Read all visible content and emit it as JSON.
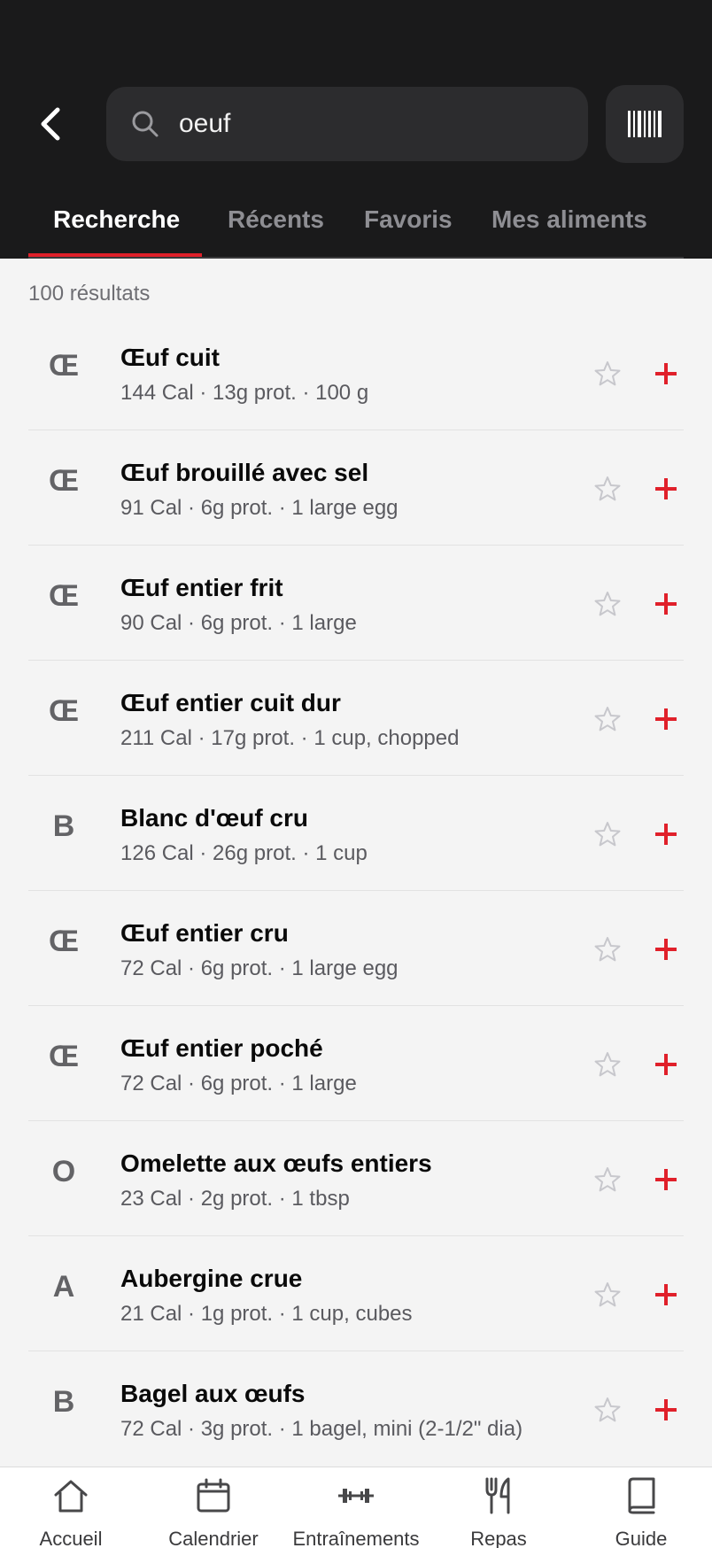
{
  "search": {
    "value": "oeuf",
    "placeholder": ""
  },
  "tabs": [
    {
      "label": "Recherche",
      "active": true
    },
    {
      "label": "Récents",
      "active": false
    },
    {
      "label": "Favoris",
      "active": false
    },
    {
      "label": "Mes aliments",
      "active": false
    }
  ],
  "results": {
    "count_label": "100 résultats",
    "items": [
      {
        "initial": "Œ",
        "name": "Œuf cuit",
        "meta": "144 Cal · 13g prot. · 100 g"
      },
      {
        "initial": "Œ",
        "name": "Œuf brouillé avec sel",
        "meta": "91 Cal · 6g prot. · 1 large egg"
      },
      {
        "initial": "Œ",
        "name": "Œuf entier frit",
        "meta": "90 Cal · 6g prot. · 1 large"
      },
      {
        "initial": "Œ",
        "name": "Œuf entier cuit dur",
        "meta": "211 Cal · 17g prot. · 1 cup, chopped"
      },
      {
        "initial": "B",
        "name": "Blanc d'œuf cru",
        "meta": "126 Cal · 26g prot. · 1 cup"
      },
      {
        "initial": "Œ",
        "name": "Œuf entier cru",
        "meta": "72 Cal · 6g prot. · 1 large egg"
      },
      {
        "initial": "Œ",
        "name": "Œuf entier poché",
        "meta": "72 Cal · 6g prot. · 1 large"
      },
      {
        "initial": "O",
        "name": "Omelette aux œufs entiers",
        "meta": "23 Cal · 2g prot. · 1 tbsp"
      },
      {
        "initial": "A",
        "name": "Aubergine crue",
        "meta": "21 Cal · 1g prot. · 1 cup, cubes"
      },
      {
        "initial": "B",
        "name": "Bagel aux œufs",
        "meta": "72 Cal · 3g prot. · 1 bagel, mini (2-1/2\" dia)"
      }
    ]
  },
  "bottom_nav": [
    {
      "label": "Accueil",
      "icon": "home-icon"
    },
    {
      "label": "Calendrier",
      "icon": "calendar-icon"
    },
    {
      "label": "Entraînements",
      "icon": "dumbbell-icon"
    },
    {
      "label": "Repas",
      "icon": "fork-knife-icon"
    },
    {
      "label": "Guide",
      "icon": "book-icon"
    }
  ],
  "colors": {
    "header_bg": "#1a1a1b",
    "accent": "#e0202a",
    "page_bg": "#f4f4f4"
  }
}
